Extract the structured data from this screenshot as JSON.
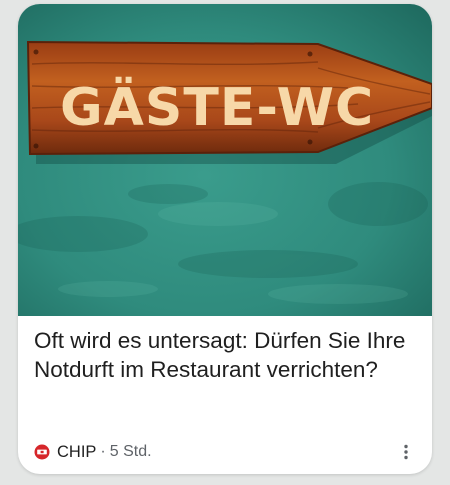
{
  "card": {
    "image": {
      "sign_text": "GÄSTE-WC",
      "background_color": "#2f8b7d",
      "sign_color": "#b4501c"
    },
    "headline": "Oft wird es untersagt: Dürfen Sie Ihre Notdurft im Restaurant verrichten?",
    "source": {
      "logo_icon": "chip-logo-icon",
      "logo_color": "#d6262a",
      "name": "CHIP",
      "separator": "·",
      "age": "5 Std."
    },
    "menu_icon": "more-vert-icon"
  }
}
